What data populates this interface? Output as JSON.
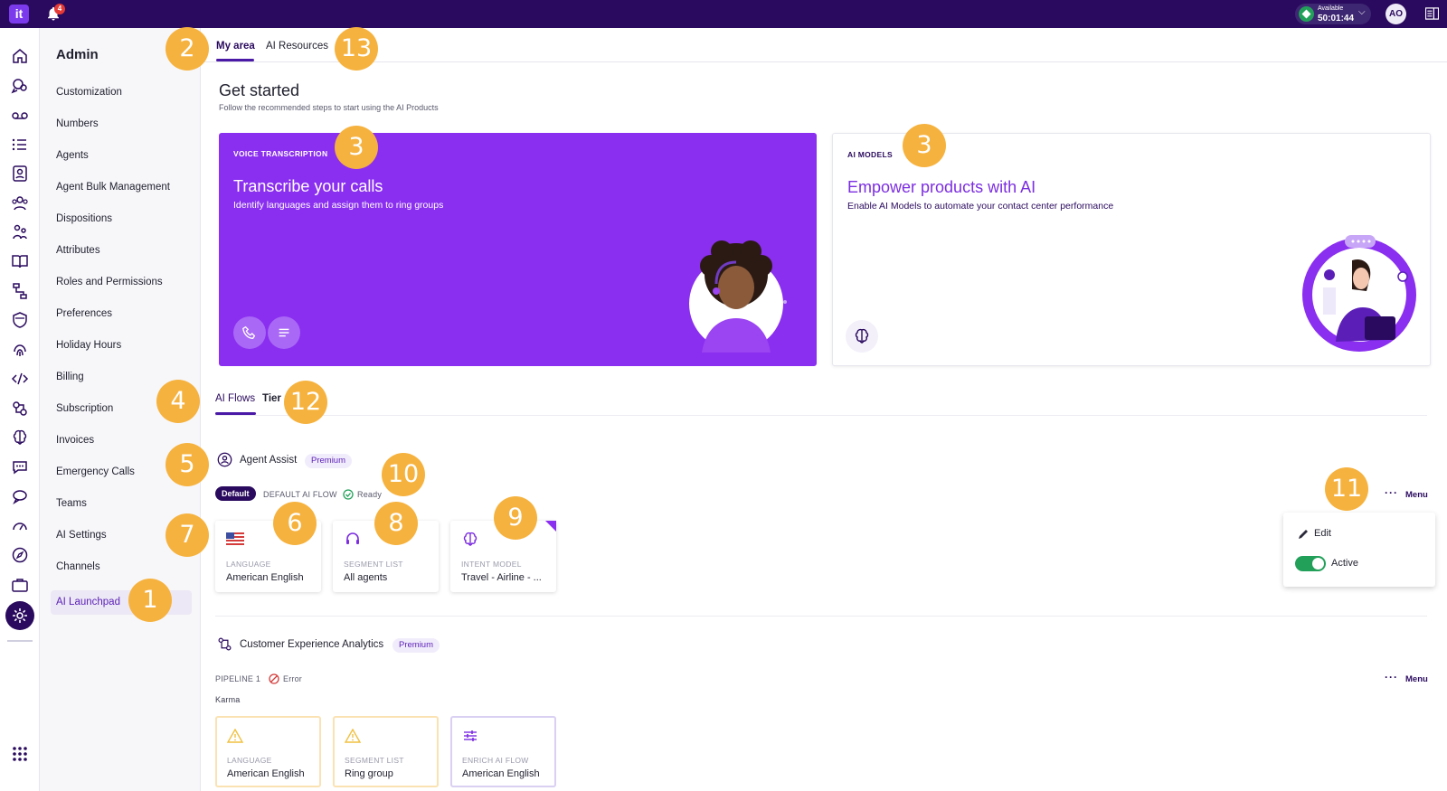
{
  "topbar": {
    "logo_text": "it",
    "notification_count": "4",
    "status_label": "Available",
    "status_time": "50:01:44",
    "user_initials": "AO",
    "brand_color": "#2a0a5e",
    "accent_color": "#8a2ef0"
  },
  "rail": {
    "icons": [
      "home-icon",
      "chat-bubbles-icon",
      "voicemail-icon",
      "list-icon",
      "contacts-icon",
      "team-icon",
      "people-icon",
      "book-icon",
      "flow-icon",
      "shield-icon",
      "fingerprint-icon",
      "code-icon",
      "settings-flow-icon",
      "brain-icon",
      "message-icon",
      "comment-icon",
      "gauge-icon",
      "compass-icon",
      "briefcase-icon",
      "gear-icon",
      "apps-grid-icon"
    ]
  },
  "admin": {
    "title": "Admin",
    "items": [
      {
        "label": "Customization"
      },
      {
        "label": "Numbers"
      },
      {
        "label": "Agents"
      },
      {
        "label": "Agent Bulk Management"
      },
      {
        "label": "Dispositions"
      },
      {
        "label": "Attributes"
      },
      {
        "label": "Roles and Permissions"
      },
      {
        "label": "Preferences"
      },
      {
        "label": "Holiday Hours"
      },
      {
        "label": "Billing"
      },
      {
        "label": "Subscription"
      },
      {
        "label": "Invoices"
      },
      {
        "label": "Emergency Calls"
      },
      {
        "label": "Teams"
      },
      {
        "label": "AI Settings"
      },
      {
        "label": "Channels"
      },
      {
        "label": "AI Launchpad"
      }
    ]
  },
  "main": {
    "tabs": [
      {
        "label": "My area"
      },
      {
        "label": "AI Resources"
      }
    ],
    "get_started": {
      "title": "Get started",
      "subtitle": "Follow the recommended steps to start using the AI Products"
    },
    "voice_card": {
      "eyebrow": "VOICE TRANSCRIPTION",
      "title": "Transcribe your calls",
      "description": "Identify languages and assign them to ring groups"
    },
    "ai_card": {
      "eyebrow": "AI MODELS",
      "title": "Empower products with AI",
      "description": "Enable AI Models to automate your contact center performance"
    },
    "flow_tabs": [
      {
        "label": "AI Flows"
      },
      {
        "label": "Tier"
      }
    ],
    "agent_assist": {
      "title": "Agent Assist",
      "badge": "Premium",
      "default_pill": "Default",
      "flow_name": "DEFAULT AI FLOW",
      "status": "Ready",
      "menu_label": "Menu",
      "cards": [
        {
          "label": "LANGUAGE",
          "value": "American English"
        },
        {
          "label": "SEGMENT LIST",
          "value": "All agents"
        },
        {
          "label": "INTENT MODEL",
          "value": "Travel - Airline - ..."
        }
      ],
      "popover": {
        "edit": "Edit",
        "active": "Active"
      }
    },
    "cx_analytics": {
      "title": "Customer Experience Analytics",
      "badge": "Premium",
      "pipeline": "PIPELINE 1",
      "status": "Error",
      "subtitle": "Karma",
      "menu_label": "Menu",
      "cards": [
        {
          "label": "LANGUAGE",
          "value": "American English"
        },
        {
          "label": "SEGMENT LIST",
          "value": "Ring group"
        },
        {
          "label": "ENRICH AI FLOW",
          "value": "American English"
        }
      ]
    }
  },
  "callouts": [
    "1",
    "2",
    "3",
    "3",
    "4",
    "5",
    "6",
    "7",
    "8",
    "9",
    "10",
    "11",
    "12",
    "13"
  ]
}
